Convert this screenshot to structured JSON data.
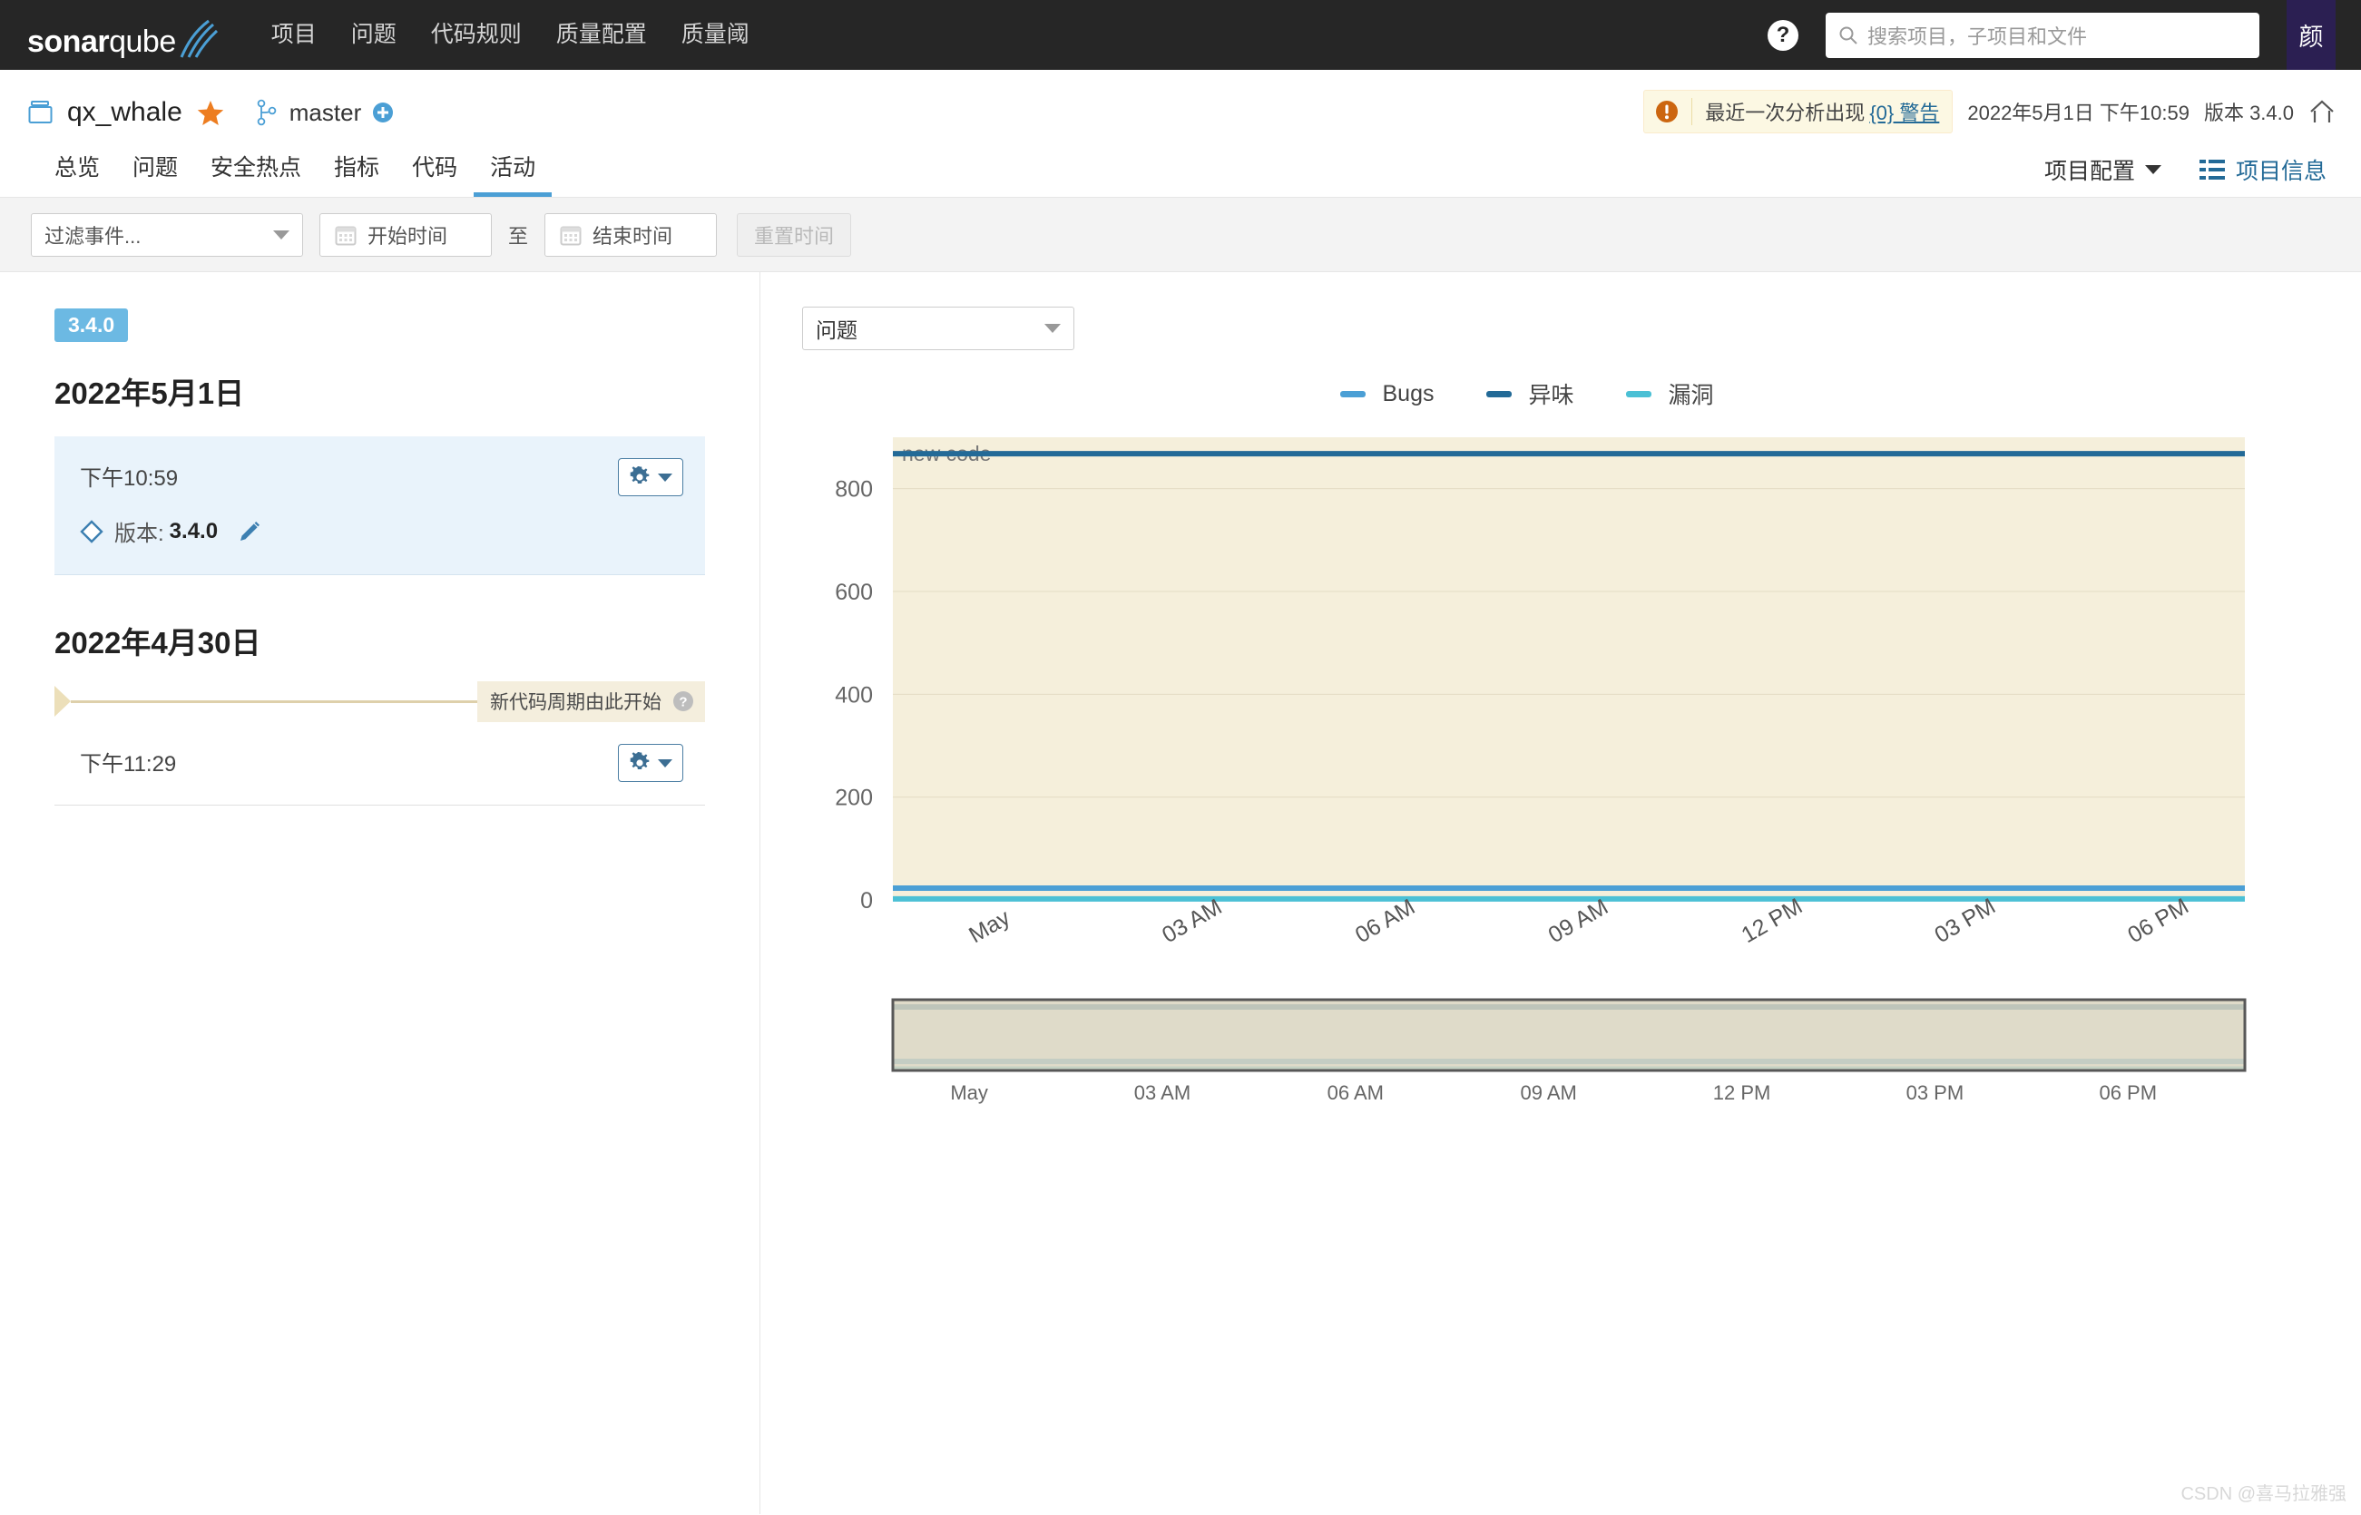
{
  "topnav": {
    "logo_bold": "sonar",
    "logo_light": "qube",
    "links": [
      {
        "label": "项目"
      },
      {
        "label": "问题"
      },
      {
        "label": "代码规则"
      },
      {
        "label": "质量配置"
      },
      {
        "label": "质量阈"
      }
    ],
    "help_glyph": "?",
    "search": {
      "placeholder": "搜索项目，子项目和文件",
      "value": "",
      "icon": "search-icon"
    },
    "avatar_initial": "颜"
  },
  "project": {
    "name": "qx_whale",
    "favorite_icon": "star-icon",
    "branch": "master",
    "branch_icon": "branch-icon",
    "add_icon": "plus-icon",
    "warning": {
      "icon": "alert-icon",
      "text": "最近一次分析出现",
      "link": "{0} 警告"
    },
    "analysis_date": "2022年5月1日 下午10:59",
    "version_label": "版本 3.4.0",
    "home_icon": "home-icon"
  },
  "tabs": {
    "items": [
      {
        "label": "总览",
        "active": false
      },
      {
        "label": "问题",
        "active": false
      },
      {
        "label": "安全热点",
        "active": false
      },
      {
        "label": "指标",
        "active": false
      },
      {
        "label": "代码",
        "active": false
      },
      {
        "label": "活动",
        "active": true
      }
    ],
    "config_label": "项目配置",
    "info_label": "项目信息"
  },
  "filters": {
    "events_placeholder": "过滤事件...",
    "start_placeholder": "开始时间",
    "end_placeholder": "结束时间",
    "to_label": "至",
    "reset_label": "重置时间"
  },
  "activity": {
    "version_badge": "3.4.0",
    "groups": [
      {
        "date": "2022年5月1日",
        "events": [
          {
            "time": "下午10:59",
            "kind_icon": "diamond-icon",
            "label": "版本:",
            "value": "3.4.0",
            "edit_icon": "pencil-icon",
            "highlighted": true
          }
        ]
      },
      {
        "date": "2022年4月30日",
        "new_code_marker": "新代码周期由此开始",
        "events": [
          {
            "time": "下午11:29",
            "highlighted": false
          }
        ]
      }
    ]
  },
  "chart_panel": {
    "metric_selected": "问题"
  },
  "chart_data": {
    "type": "line",
    "title": "",
    "xlabel": "",
    "ylabel": "",
    "ylim": [
      0,
      900
    ],
    "yticks": [
      0,
      200,
      400,
      600,
      800
    ],
    "ytick_labels": [
      "0",
      "200",
      "400",
      "600",
      "800"
    ],
    "xtick_labels": [
      "May",
      "03 AM",
      "06 AM",
      "09 AM",
      "12 PM",
      "03 PM",
      "06 PM"
    ],
    "xtick_rotation": -30,
    "grid": true,
    "legend_position": "top-center",
    "annotations": [
      {
        "text": "new code",
        "type": "band-label"
      }
    ],
    "bands": [
      {
        "label": "new code",
        "color": "#f5efdb",
        "from": 0,
        "to": 900
      }
    ],
    "series": [
      {
        "name": "Bugs",
        "color": "#4b9fd5",
        "values": [
          23,
          23,
          23,
          23,
          23,
          23,
          23
        ]
      },
      {
        "name": "异味",
        "color": "#236a97",
        "values": [
          868,
          868,
          868,
          868,
          868,
          868,
          868
        ]
      },
      {
        "name": "漏洞",
        "color": "#4bc0d5",
        "values": [
          2,
          2,
          2,
          2,
          2,
          2,
          2
        ]
      }
    ],
    "brush": {
      "xtick_labels": [
        "May",
        "03 AM",
        "06 AM",
        "09 AM",
        "12 PM",
        "03 PM",
        "06 PM"
      ],
      "selection": {
        "from": 0,
        "to": 1,
        "fill": "#d9d5c0",
        "border": "#575757"
      }
    }
  },
  "watermark": "CSDN @喜马拉雅强"
}
